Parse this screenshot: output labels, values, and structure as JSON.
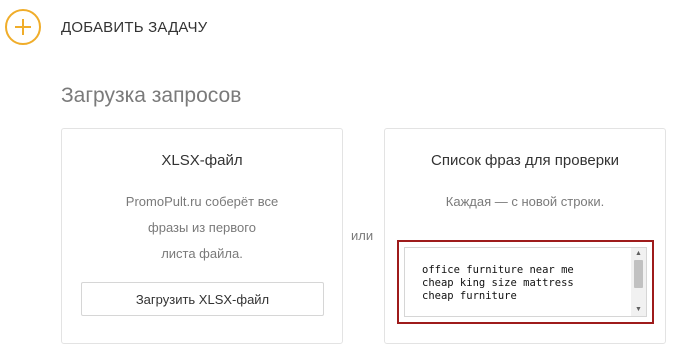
{
  "header": {
    "add_task_label": "ДОБАВИТЬ ЗАДАЧУ",
    "add_icon": "plus-circle-icon",
    "accent_color": "#f0ad2a"
  },
  "section": {
    "title": "Загрузка запросов"
  },
  "xlsx_card": {
    "title": "XLSX-файл",
    "desc_lines": [
      "PromoPult.ru соберёт все",
      "фразы из первого",
      "листа файла."
    ],
    "button_label": "Загрузить XLSX-файл"
  },
  "separator": {
    "or_label": "или"
  },
  "phrases_card": {
    "title": "Список фраз для проверки",
    "desc": "Каждая — с новой строки.",
    "phrases_value": "office furniture near me\ncheap king size mattress\ncheap furniture",
    "highlight_color": "#9e1b1b",
    "scroll_up_icon": "chevron-up-icon",
    "scroll_down_icon": "chevron-down-icon"
  }
}
